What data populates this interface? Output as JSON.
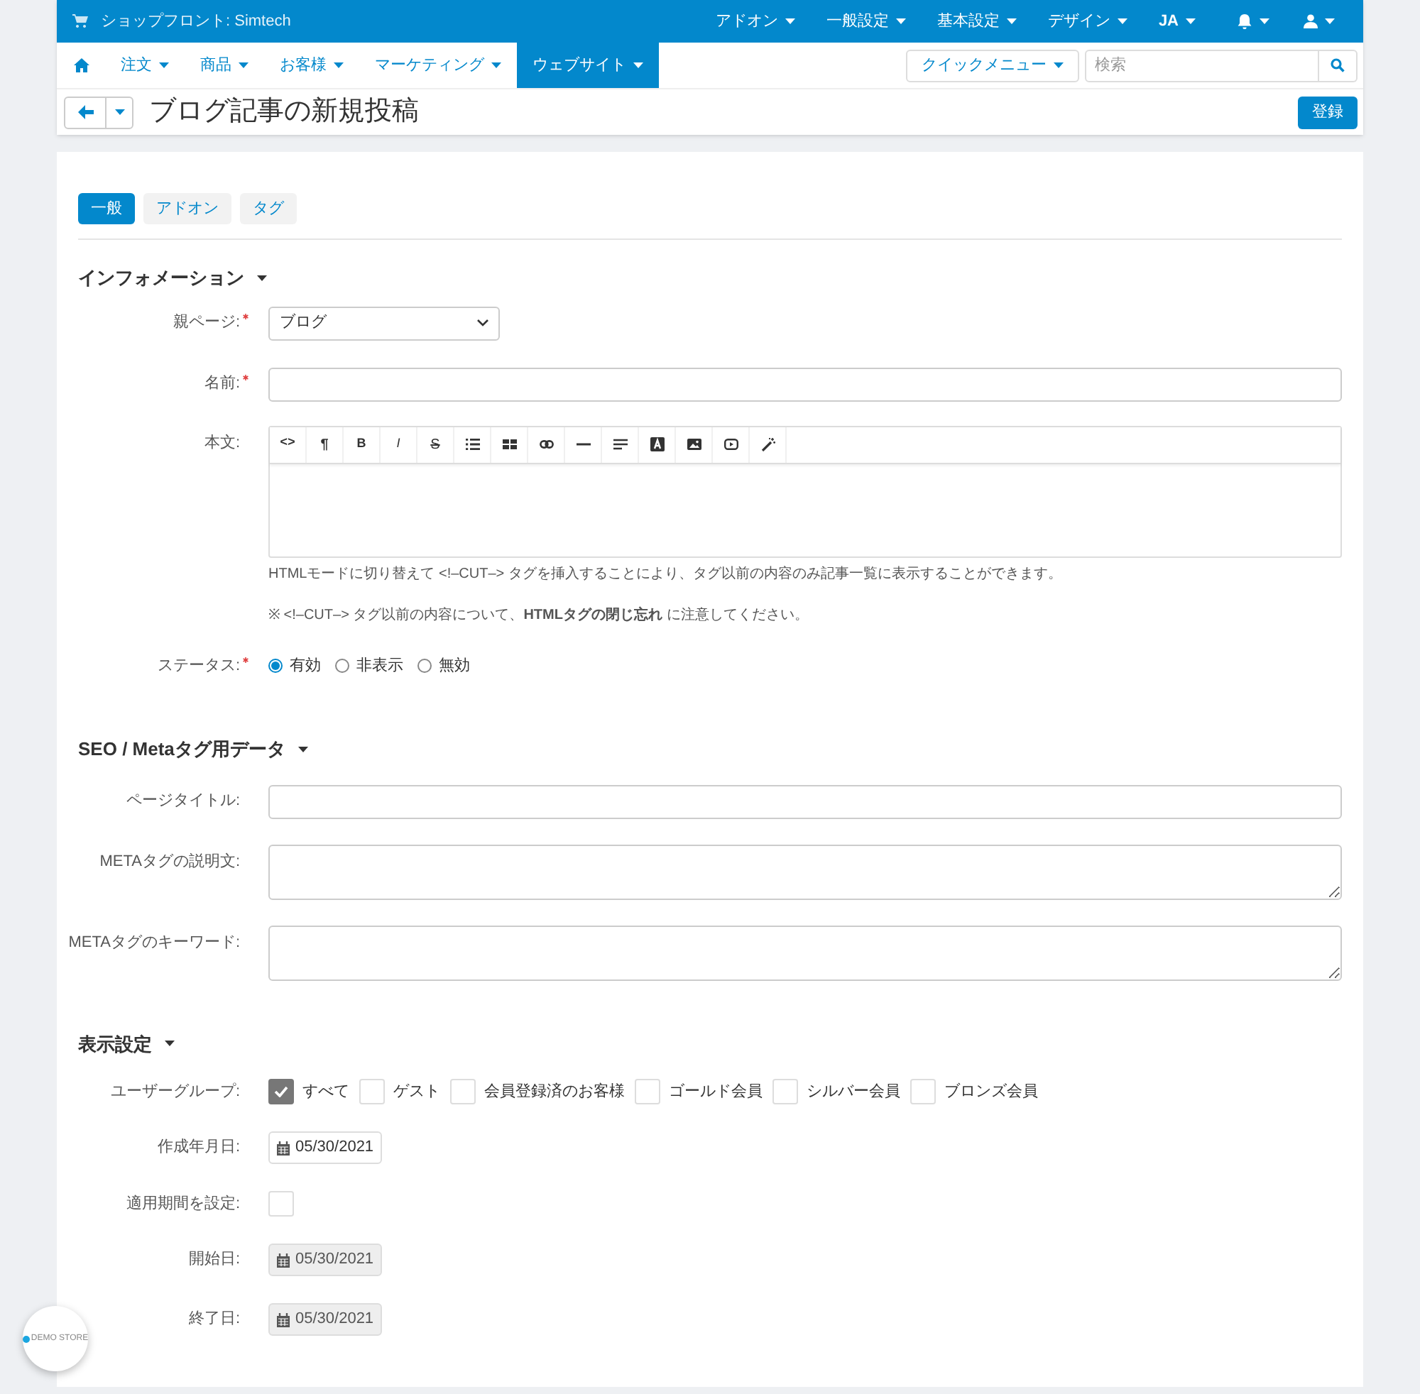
{
  "top_bar": {
    "store": "ショップフロント: Simtech",
    "menus": [
      {
        "label": "アドオン"
      },
      {
        "label": "一般設定"
      },
      {
        "label": "基本設定"
      },
      {
        "label": "デザイン"
      },
      {
        "label": "JA"
      }
    ]
  },
  "nav": {
    "items": [
      {
        "label": "注文",
        "selected": false
      },
      {
        "label": "商品",
        "selected": false
      },
      {
        "label": "お客様",
        "selected": false
      },
      {
        "label": "マーケティング",
        "selected": false
      },
      {
        "label": "ウェブサイト",
        "selected": true
      }
    ],
    "quick_menu": "クイックメニュー",
    "search": {
      "placeholder": "検索"
    }
  },
  "page": {
    "title": "ブログ記事の新規投稿",
    "save_button": "登録"
  },
  "tabs": [
    {
      "label": "一般",
      "selected": true
    },
    {
      "label": "アドオン",
      "selected": false
    },
    {
      "label": "タグ",
      "selected": false
    }
  ],
  "info": {
    "heading": "インフォメーション",
    "parent_label": "親ページ:",
    "parent_value": "ブログ",
    "name_label": "名前:",
    "body_label": "本文:",
    "toolbar_glyphs": [
      "<>",
      "¶",
      "B",
      "I",
      "S"
    ],
    "help": "HTMLモードに切り替えて <!–CUT–> タグを挿入することにより、タグ以前の内容のみ記事一覧に表示することができます。",
    "note": "※ <!–CUT–> タグ以前の内容について、**HTMLタグの閉じ忘れ** に注意してください。",
    "status_label": "ステータス:",
    "statuses": [
      {
        "label": "有効",
        "selected": true
      },
      {
        "label": "非表示",
        "selected": false
      },
      {
        "label": "無効",
        "selected": false
      }
    ]
  },
  "seo": {
    "heading": "SEO / Metaタグ用データ",
    "fields": [
      {
        "label": "ページタイトル:",
        "kind": "input"
      },
      {
        "label": "METAタグの説明文:",
        "kind": "textarea"
      },
      {
        "label": "METAタグのキーワード:",
        "kind": "textarea"
      }
    ]
  },
  "display": {
    "heading": "表示設定",
    "groups_label": "ユーザーグループ:",
    "groups": [
      {
        "label": "すべて",
        "checked": true
      },
      {
        "label": "ゲスト",
        "checked": false
      },
      {
        "label": "会員登録済のお客様",
        "checked": false
      },
      {
        "label": "ゴールド会員",
        "checked": false
      },
      {
        "label": "シルバー会員",
        "checked": false
      },
      {
        "label": "ブロンズ会員",
        "checked": false
      }
    ],
    "created_label": "作成年月日:",
    "created": {
      "value": "05/30/2021",
      "disabled": false
    },
    "period_label": "適用期間を設定:",
    "period_checked": false,
    "start_label": "開始日:",
    "start": {
      "value": "05/30/2021",
      "disabled": true
    },
    "end_label": "終了日:",
    "end": {
      "value": "05/30/2021",
      "disabled": true
    }
  },
  "badge": {
    "text": "DEMO STORE"
  }
}
